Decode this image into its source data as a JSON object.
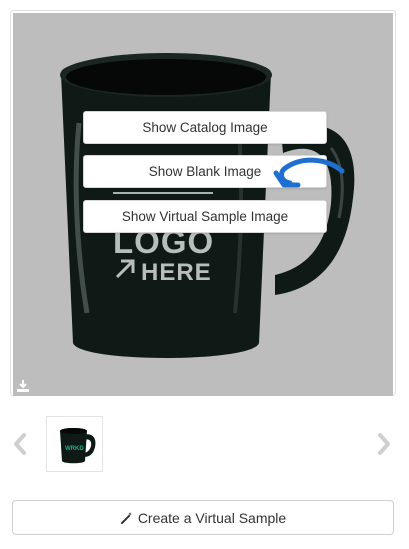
{
  "preview": {
    "buttons": {
      "catalog": "Show Catalog Image",
      "blank": "Show Blank Image",
      "virtual": "Show Virtual Sample Image"
    },
    "image_text": {
      "line1": "LOGO",
      "line2": "HERE"
    },
    "download_icon": "download-icon"
  },
  "thumbnails": {
    "prev_icon": "chevron-left-icon",
    "next_icon": "chevron-right-icon",
    "thumb_text": "WRKD"
  },
  "actions": {
    "create_virtual_sample": "Create a Virtual Sample",
    "wand_icon": "magic-wand-icon"
  },
  "colors": {
    "preview_background": "#bdbdbd",
    "mug": "#0f1a17",
    "annotation_arrow": "#1f6fd1",
    "thumb_logo": "#17b08a"
  }
}
